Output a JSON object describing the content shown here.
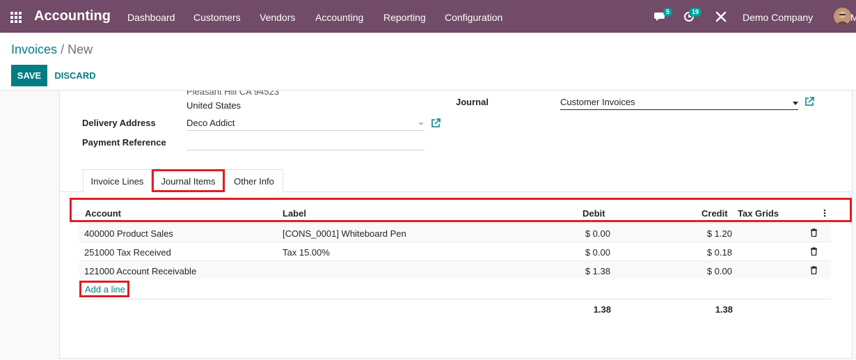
{
  "navbar": {
    "app_name": "Accounting",
    "menu": [
      "Dashboard",
      "Customers",
      "Vendors",
      "Accounting",
      "Reporting",
      "Configuration"
    ],
    "messages_count": "5",
    "activities_count": "19",
    "company": "Demo Company",
    "user_initial": "M",
    "icons": [
      "apps-grid-icon",
      "chat-icon",
      "clock-icon",
      "tools-icon"
    ]
  },
  "breadcrumb": {
    "parent": "Invoices",
    "separator": "/",
    "current": "New"
  },
  "buttons": {
    "save": "SAVE",
    "discard": "DISCARD"
  },
  "form": {
    "address_line_cut": "Pleasant Hill CA 94523",
    "address_country": "United States",
    "delivery_address_label": "Delivery Address",
    "delivery_address_value": "Deco Addict",
    "payment_reference_label": "Payment Reference",
    "payment_reference_value": "",
    "journal_label": "Journal",
    "journal_value": "Customer Invoices"
  },
  "tabs": [
    {
      "label": "Invoice Lines",
      "active": false
    },
    {
      "label": "Journal Items",
      "active": true
    },
    {
      "label": "Other Info",
      "active": false
    }
  ],
  "table": {
    "columns": [
      "Account",
      "Label",
      "Debit",
      "Credit",
      "Tax Grids"
    ],
    "rows": [
      {
        "account": "400000 Product Sales",
        "label": "[CONS_0001] Whiteboard Pen",
        "debit": "$ 0.00",
        "credit": "$ 1.20",
        "tax_grids": ""
      },
      {
        "account": "251000 Tax Received",
        "label": "Tax 15.00%",
        "debit": "$ 0.00",
        "credit": "$ 0.18",
        "tax_grids": ""
      },
      {
        "account": "121000 Account Receivable",
        "label": "",
        "debit": "$ 1.38",
        "credit": "$ 0.00",
        "tax_grids": ""
      }
    ],
    "add_line": "Add a line",
    "total_debit": "1.38",
    "total_credit": "1.38"
  },
  "colors": {
    "navbar": "#714b67",
    "primary": "#017e84",
    "highlight": "#e11d24",
    "badge": "#00a09d"
  }
}
